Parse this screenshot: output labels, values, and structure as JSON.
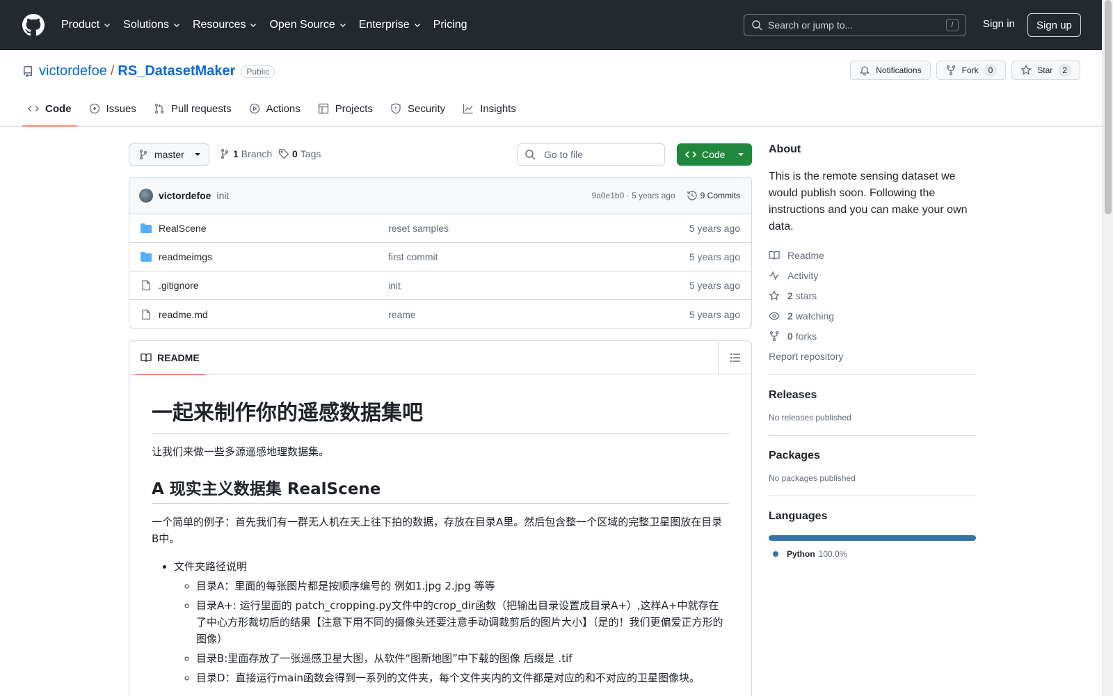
{
  "header": {
    "nav": [
      "Product",
      "Solutions",
      "Resources",
      "Open Source",
      "Enterprise",
      "Pricing"
    ],
    "nav_has_chevron": [
      true,
      true,
      true,
      true,
      true,
      false
    ],
    "search_placeholder": "Search or jump to...",
    "search_shortcut": "/",
    "sign_in": "Sign in",
    "sign_up": "Sign up"
  },
  "repo": {
    "owner": "victordefoe",
    "separator": "/",
    "name": "RS_DatasetMaker",
    "visibility": "Public",
    "notifications_label": "Notifications",
    "fork_label": "Fork",
    "fork_count": "0",
    "star_label": "Star",
    "star_count": "2"
  },
  "tabs": [
    "Code",
    "Issues",
    "Pull requests",
    "Actions",
    "Projects",
    "Security",
    "Insights"
  ],
  "toolbar": {
    "branch": "master",
    "branch_count": "1",
    "branch_label": "Branch",
    "tag_count": "0",
    "tag_label": "Tags",
    "go_to_file": "Go to file",
    "code_button": "Code"
  },
  "latest_commit": {
    "author": "victordefoe",
    "message": "init",
    "hash_age": "9a0e1b0 · 5 years ago",
    "commits": "9 Commits"
  },
  "files": [
    {
      "name": "RealScene",
      "type": "folder",
      "message": "reset samples",
      "age": "5 years ago"
    },
    {
      "name": "readmeimgs",
      "type": "folder",
      "message": "first commit",
      "age": "5 years ago"
    },
    {
      "name": ".gitignore",
      "type": "file",
      "message": "init",
      "age": "5 years ago"
    },
    {
      "name": "readme.md",
      "type": "file",
      "message": "reame",
      "age": "5 years ago"
    }
  ],
  "readme": {
    "tab_label": "README",
    "h1": "一起来制作你的遥感数据集吧",
    "intro": "让我们来做一些多源遥感地理数据集。",
    "h2": "A 现实主义数据集 RealScene",
    "para": "一个简单的例子：首先我们有一群无人机在天上往下拍的数据，存放在目录A里。然后包含整一个区域的完整卫星图放在目录B中。",
    "list_title": "文件夹路径说明",
    "sub_items": [
      "目录A：里面的每张图片都是按顺序编号的 例如1.jpg 2.jpg 等等",
      "目录A+: 运行里面的 patch_cropping.py文件中的crop_dir函数（把输出目录设置成目录A+）,这样A+中就存在了中心方形裁切后的结果【注意下用不同的摄像头还要注意手动调裁剪后的图片大小】（是的！我们更偏爱正方形的图像）",
      "目录B:里面存放了一张遥感卫星大图，从软件“图新地图”中下载的图像 后缀是 .tif",
      "目录D：直接运行main函数会得到一系列的文件夹，每个文件夹内的文件都是对应的和不对应的卫星图像块。"
    ]
  },
  "sidebar": {
    "about_title": "About",
    "about_text": "This is the remote sensing dataset we would publish soon. Following the instructions and you can make your own data.",
    "readme": "Readme",
    "activity": "Activity",
    "stars_count": "2",
    "stars_label": "stars",
    "watching_count": "2",
    "watching_label": "watching",
    "forks_count": "0",
    "forks_label": "forks",
    "report": "Report repository",
    "releases_title": "Releases",
    "releases_text": "No releases published",
    "packages_title": "Packages",
    "packages_text": "No packages published",
    "languages_title": "Languages",
    "language_name": "Python",
    "language_pct": "100.0%",
    "language_color": "#3572A5"
  },
  "colors": {
    "header_bg": "#24292f",
    "link": "#0969da",
    "green": "#1f883d",
    "folder": "#54aeff",
    "active_tab": "#fd8c73"
  }
}
